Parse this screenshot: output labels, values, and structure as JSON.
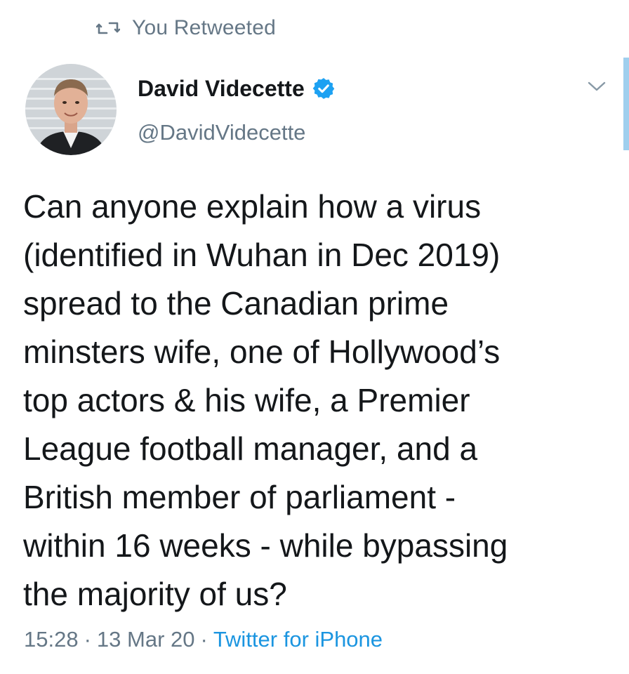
{
  "retweet": {
    "label": "You Retweeted",
    "icon": "retweet-icon"
  },
  "tweet": {
    "author": {
      "display_name": "David Videcette",
      "handle": "@DavidVidecette",
      "verified": true,
      "verified_icon": "verified-badge-icon",
      "avatar_icon": "avatar"
    },
    "menu_icon": "chevron-down-icon",
    "text": "Can anyone explain how a virus\n(identified in Wuhan in Dec 2019)\nspread to the Canadian prime\nminsters wife, one of Hollywood’s\ntop actors & his wife, a Premier\nLeague football manager, and a\nBritish member of parliament -\nwithin 16 weeks - while bypassing\nthe majority of us?",
    "time": "15:28",
    "date": "13 Mar 20",
    "separator": "·",
    "source": "Twitter for iPhone"
  },
  "colors": {
    "text_primary": "#14171a",
    "text_secondary": "#657786",
    "link": "#1b95e0",
    "verified": "#1da1f2"
  }
}
